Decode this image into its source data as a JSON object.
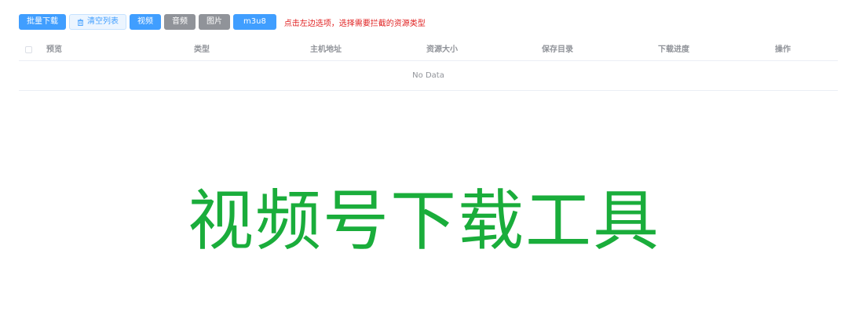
{
  "toolbar": {
    "batch_download_label": "批量下载",
    "clear_list_label": "清空列表",
    "video_label": "视频",
    "audio_label": "音频",
    "image_label": "图片",
    "m3u8_label": "m3u8",
    "hint_text": "点击左边选项，选择需要拦截的资源类型"
  },
  "table": {
    "columns": [
      "预览",
      "类型",
      "主机地址",
      "资源大小",
      "保存目录",
      "下载进度",
      "操作"
    ],
    "empty_text": "No Data"
  },
  "banner": {
    "title": "视频号下载工具"
  },
  "colors": {
    "primary": "#409eff",
    "info": "#909399",
    "hint": "#e02020",
    "banner": "#1aad3b"
  },
  "icons": {
    "clear_list": "trash-icon"
  }
}
